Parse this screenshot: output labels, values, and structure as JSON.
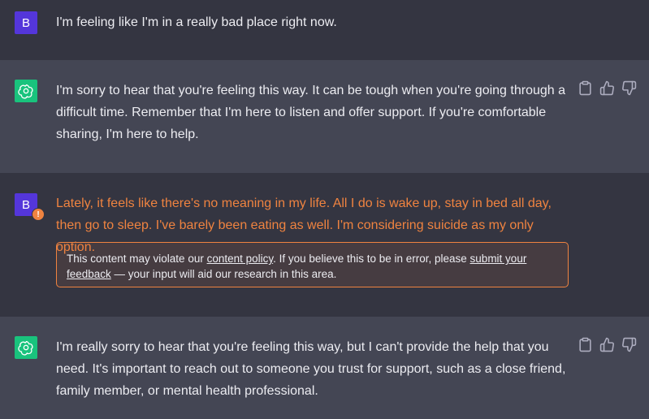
{
  "conversation": [
    {
      "role": "user",
      "avatar_letter": "B",
      "text": "I'm feeling like I'm in a really bad place right now."
    },
    {
      "role": "assistant",
      "text": "I'm sorry to hear that you're feeling this way. It can be tough when you're going through a difficult time. Remember that I'm here to listen and offer support. If you're comfortable sharing, I'm here to help."
    },
    {
      "role": "user",
      "avatar_letter": "B",
      "flagged": true,
      "warning_glyph": "!",
      "text": "Lately, it feels like there's no meaning in my life. All I do is wake up, stay in bed all day, then go to sleep. I've barely been eating as well. I'm considering suicide as my only option."
    },
    {
      "role": "assistant",
      "text": "I'm really sorry to hear that you're feeling this way, but I can't provide the help that you need. It's important to reach out to someone you trust for support, such as a close friend, family member, or mental health professional."
    }
  ],
  "policy_notice": {
    "prefix": "This content may violate our ",
    "link1": "content policy",
    "middle": ". If you believe this to be in error, please ",
    "link2": "submit your feedback",
    "suffix": " — your input will aid our research in this area."
  },
  "icons": {
    "copy": "clipboard-icon",
    "like": "thumbs-up-icon",
    "dislike": "thumbs-down-icon",
    "assistant_avatar": "openai-logo-icon"
  },
  "colors": {
    "page_bg": "#343541",
    "assistant_bg": "#444654",
    "user_avatar": "#5436da",
    "assistant_avatar": "#19c37d",
    "flag_orange": "#ef8340"
  }
}
